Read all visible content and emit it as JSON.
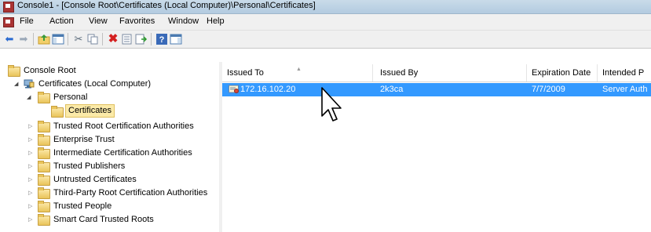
{
  "window": {
    "title": "Console1 - [Console Root\\Certificates (Local Computer)\\Personal\\Certificates]"
  },
  "menu": [
    "File",
    "Action",
    "View",
    "Favorites",
    "Window",
    "Help"
  ],
  "toolbar_icons": [
    "back-arrow-icon",
    "forward-arrow-icon",
    "up-folder-icon",
    "show-hide-console-tree-icon",
    "cut-icon",
    "copy-icon",
    "delete-icon",
    "properties-icon",
    "export-list-icon",
    "help-icon",
    "action-pane-icon"
  ],
  "tree": {
    "items": [
      {
        "label": "Console Root"
      },
      {
        "label": "Certificates (Local Computer)"
      },
      {
        "label": "Personal"
      },
      {
        "label": "Certificates"
      },
      {
        "label": "Trusted Root Certification Authorities"
      },
      {
        "label": "Enterprise Trust"
      },
      {
        "label": "Intermediate Certification Authorities"
      },
      {
        "label": "Trusted Publishers"
      },
      {
        "label": "Untrusted Certificates"
      },
      {
        "label": "Third-Party Root Certification Authorities"
      },
      {
        "label": "Trusted People"
      },
      {
        "label": "Smart Card Trusted Roots"
      }
    ]
  },
  "list": {
    "columns": [
      "Issued To",
      "Issued By",
      "Expiration Date",
      "Intended P"
    ],
    "rows": [
      {
        "issued_to": "172.16.102.20",
        "issued_by": "2k3ca",
        "expiration": "7/7/2009",
        "purpose": "Server Auth"
      }
    ]
  },
  "colors": {
    "selection": "#3399ff",
    "tree_selection": "#fbeaa8"
  }
}
